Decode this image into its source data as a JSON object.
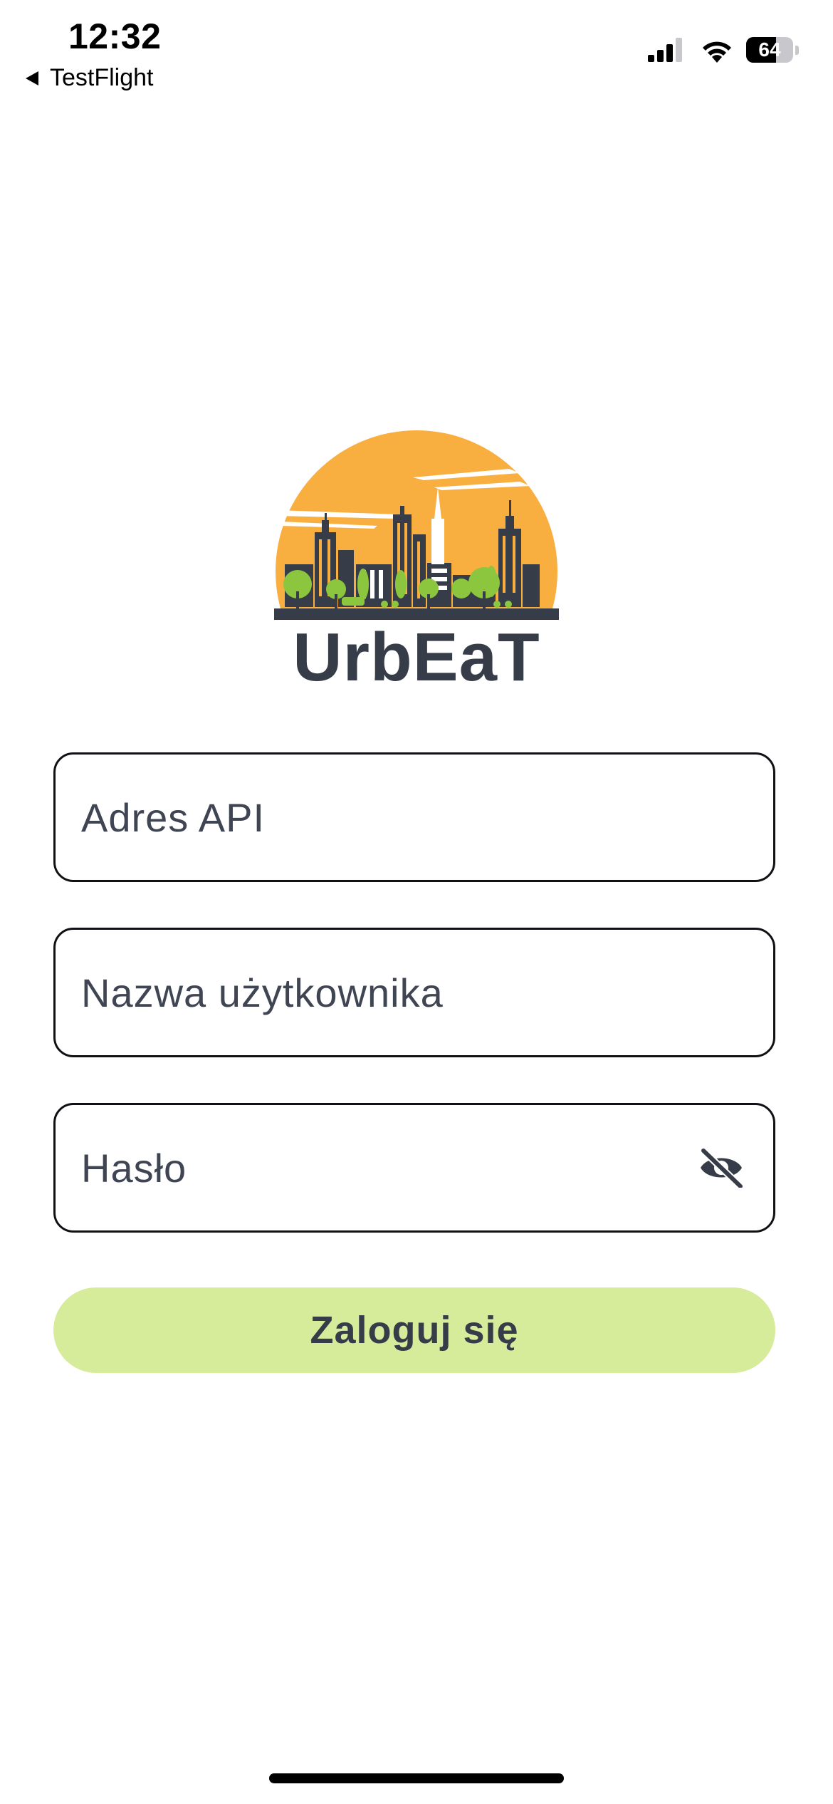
{
  "status_bar": {
    "time": "12:32",
    "back_app": "TestFlight",
    "battery_level": 64,
    "battery_label": "64"
  },
  "logo": {
    "text": "UrbEaT",
    "colors": {
      "sun": "#F9AE40",
      "buildings": "#363C48",
      "trees": "#8CC63F"
    }
  },
  "form": {
    "api_placeholder": "Adres API",
    "username_placeholder": "Nazwa użytkownika",
    "password_placeholder": "Hasło",
    "password_toggle_icon": "eye-off-icon"
  },
  "login_button": {
    "label": "Zaloguj się",
    "color": "#D6EC9B"
  }
}
